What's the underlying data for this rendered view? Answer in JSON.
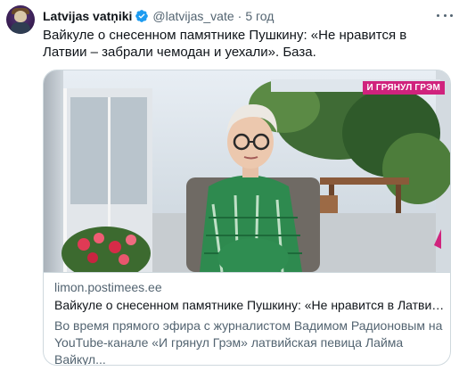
{
  "author": {
    "display_name": "Latvijas vatņiki",
    "handle": "@latvijas_vate",
    "separator": "·",
    "time": "5 год"
  },
  "tweet": {
    "text": "Вайкуле о снесенном памятнике Пушкину: «Не нравится в Латвии – забрали чемодан и уехали». База."
  },
  "card": {
    "badge": "И ГРЯНУЛ ГРЭМ",
    "domain": "limon.postimees.ee",
    "title": "Вайкуле о снесенном памятнике Пушкину: «Не нравится в Латвии ...",
    "description": "Во время прямого эфира с журналистом Вадимом Радионовым на YouTube-канале «И грянул Грэм» латвийская певица Лайма Вайкул..."
  },
  "colors": {
    "verified_blue": "#1d9bf0",
    "secondary_text": "#536471",
    "border": "#cfd9de",
    "badge_pink": "#d0237d"
  },
  "icons": {
    "verified": "verified-badge-icon",
    "more": "more-options-icon"
  }
}
